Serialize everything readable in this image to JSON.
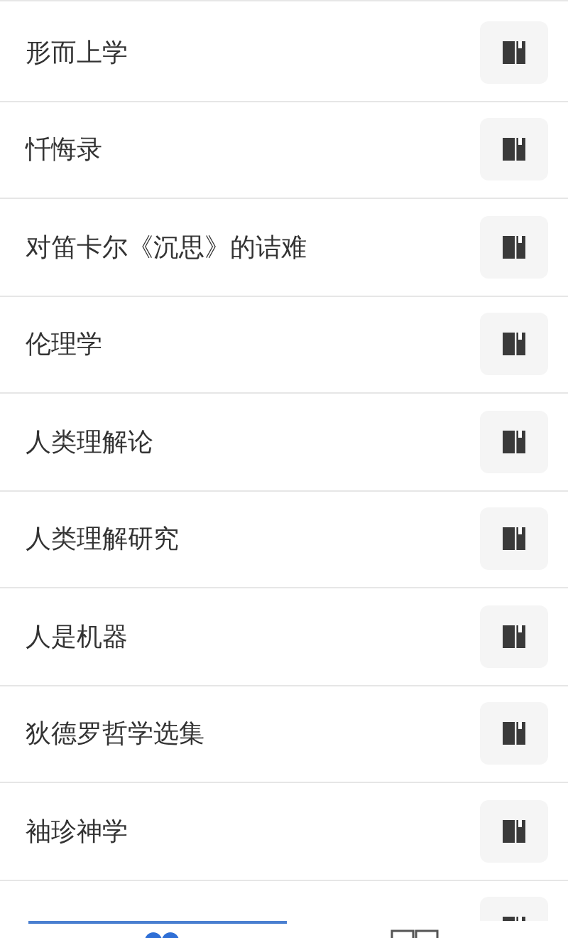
{
  "books": [
    {
      "title": "形而上学"
    },
    {
      "title": "忏悔录"
    },
    {
      "title": "对笛卡尔《沉思》的诘难"
    },
    {
      "title": "伦理学"
    },
    {
      "title": "人类理解论"
    },
    {
      "title": "人类理解研究"
    },
    {
      "title": "人是机器"
    },
    {
      "title": "狄德罗哲学选集"
    },
    {
      "title": "袖珍神学"
    }
  ],
  "partial_row_below": true,
  "tab_bar": {
    "tabs": [
      {
        "kind": "grid",
        "selected": true
      },
      {
        "kind": "book",
        "selected": false
      }
    ]
  }
}
